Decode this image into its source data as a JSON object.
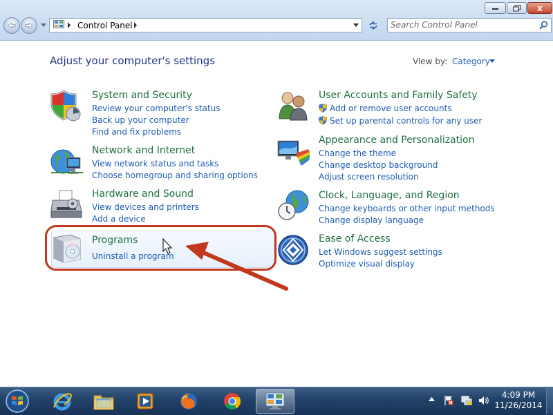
{
  "window": {
    "caption_close": "x"
  },
  "address": {
    "location": "Control Panel"
  },
  "search": {
    "placeholder": "Search Control Panel"
  },
  "header": {
    "title": "Adjust your computer's settings",
    "view_by_label": "View by:",
    "view_by_value": "Category"
  },
  "categories": {
    "system_security": {
      "title": "System and Security",
      "links": [
        "Review your computer's status",
        "Back up your computer",
        "Find and fix problems"
      ]
    },
    "network_internet": {
      "title": "Network and Internet",
      "links": [
        "View network status and tasks",
        "Choose homegroup and sharing options"
      ]
    },
    "hardware_sound": {
      "title": "Hardware and Sound",
      "links": [
        "View devices and printers",
        "Add a device"
      ]
    },
    "programs": {
      "title": "Programs",
      "links": [
        "Uninstall a program"
      ]
    },
    "user_accounts": {
      "title": "User Accounts and Family Safety",
      "links": [
        "Add or remove user accounts",
        "Set up parental controls for any user"
      ]
    },
    "appearance": {
      "title": "Appearance and Personalization",
      "links": [
        "Change the theme",
        "Change desktop background",
        "Adjust screen resolution"
      ]
    },
    "clock_region": {
      "title": "Clock, Language, and Region",
      "links": [
        "Change keyboards or other input methods",
        "Change display language"
      ]
    },
    "ease_access": {
      "title": "Ease of Access",
      "links": [
        "Let Windows suggest settings",
        "Optimize visual display"
      ]
    }
  },
  "taskbar": {
    "apps": [
      "internet-explorer",
      "windows-explorer",
      "windows-media-player",
      "firefox",
      "chrome",
      "control-panel"
    ],
    "time": "4:09 PM",
    "date": "11/26/2014"
  },
  "colors": {
    "category_title": "#1e7040",
    "link": "#1e5cb3",
    "page_title": "#1e3287",
    "annotation": "#c1381e"
  }
}
